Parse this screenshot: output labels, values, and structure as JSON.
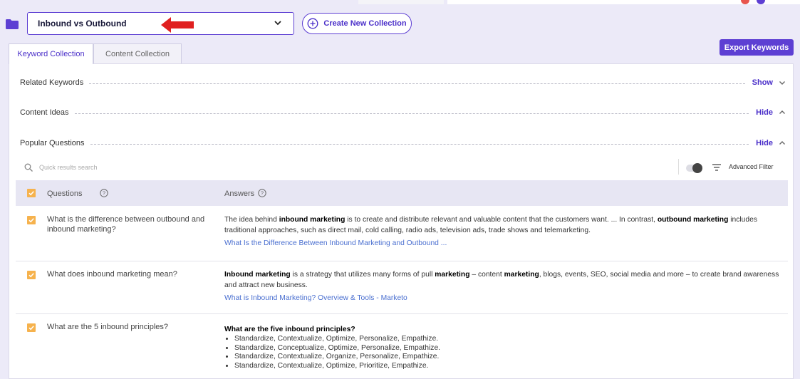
{
  "header": {
    "selected_collection": "Inbound vs Outbound",
    "create_button": "Create New Collection",
    "export_button": "Export Keywords"
  },
  "tabs": [
    {
      "label": "Keyword Collection",
      "active": true
    },
    {
      "label": "Content Collection",
      "active": false
    }
  ],
  "sections": [
    {
      "label": "Related Keywords",
      "action": "Show"
    },
    {
      "label": "Content Ideas",
      "action": "Hide"
    },
    {
      "label": "Popular Questions",
      "action": "Hide"
    }
  ],
  "search": {
    "placeholder": "Quick results search"
  },
  "filter": {
    "label": "Advanced Filter",
    "toggle_on": false
  },
  "table": {
    "col_questions": "Questions",
    "col_answers": "Answers",
    "rows": [
      {
        "question": "What is the difference between outbound and inbound marketing?",
        "answer_parts": [
          "The idea behind ",
          "inbound marketing",
          " is to create and distribute relevant and valuable content that the customers want. ... In contrast, ",
          "outbound marketing",
          " includes traditional approaches, such as direct mail, cold calling, radio ads, television ads, trade shows and telemarketing."
        ],
        "source": "What Is the Difference Between Inbound Marketing and Outbound ..."
      },
      {
        "question": "What does inbound marketing mean?",
        "answer_parts": [
          "Inbound marketing",
          " is a strategy that utilizes many forms of pull ",
          "marketing",
          " – content ",
          "marketing",
          ", blogs, events, SEO, social media and more – to create brand awareness and attract new business."
        ],
        "source": "What is Inbound Marketing? Overview & Tools - Marketo"
      },
      {
        "question": "What are the 5 inbound principles?",
        "answer_title": "What are the five inbound principles?",
        "answer_list": [
          "Standardize, Contextualize, Optimize, Personalize, Empathize.",
          "Standardize, Conceptualize, Optimize, Personalize, Empathize.",
          "Standardize, Contextualize, Organize, Personalize, Empathize.",
          "Standardize, Contextualize, Optimize, Prioritize, Empathize."
        ]
      }
    ]
  },
  "colors": {
    "accent": "#5d3fd3",
    "checkbox": "#f6b24d",
    "link": "#4a6fd0",
    "annotation_arrow": "#e02020"
  }
}
